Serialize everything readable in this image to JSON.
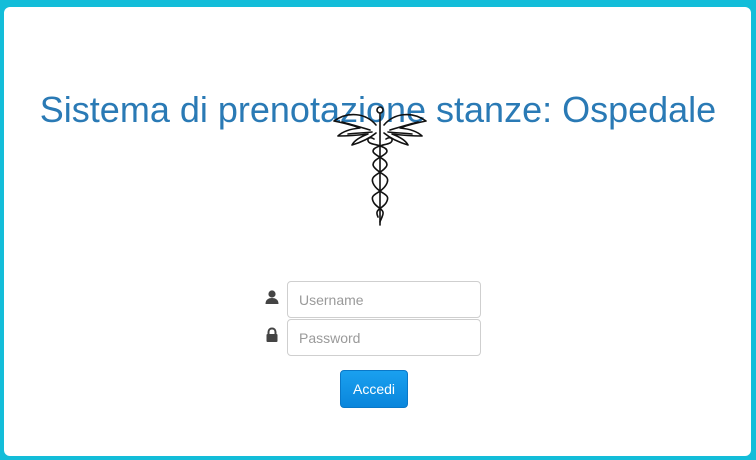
{
  "header": {
    "title": "Sistema di prenotazione stanze: Ospedale"
  },
  "logo": {
    "icon": "caduceus-icon"
  },
  "login_form": {
    "username": {
      "icon": "user-icon",
      "placeholder": "Username",
      "value": ""
    },
    "password": {
      "icon": "lock-icon",
      "placeholder": "Password",
      "value": ""
    },
    "submit_label": "Accedi"
  },
  "colors": {
    "frame": "#13bdd9",
    "title": "#2a7ab5",
    "button": "#0a86dc"
  }
}
